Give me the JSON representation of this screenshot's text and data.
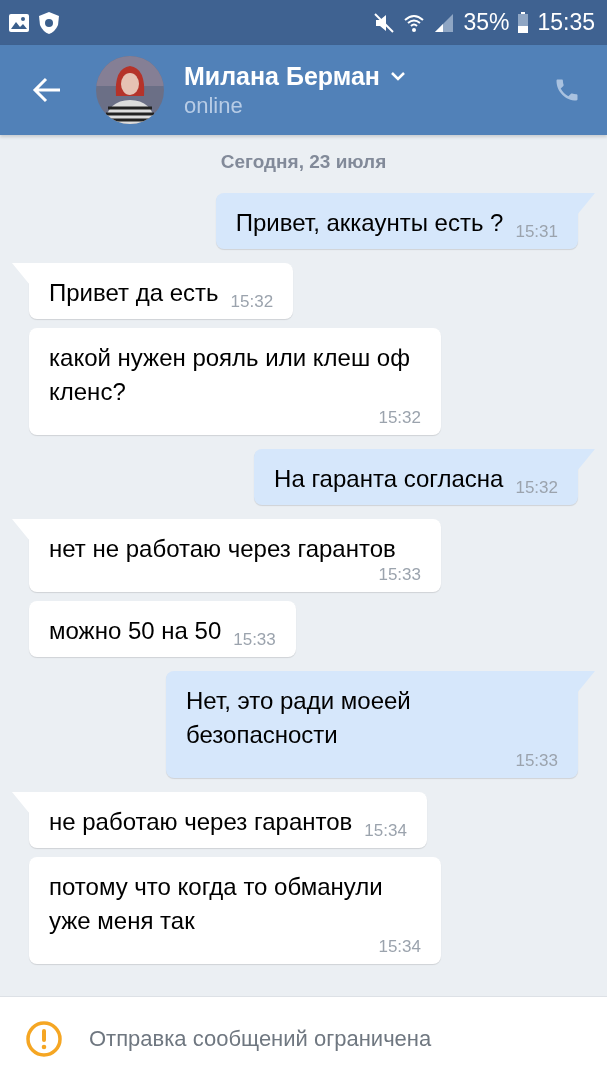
{
  "status_bar": {
    "battery": "35%",
    "time": "15:35"
  },
  "header": {
    "name": "Милана Берман",
    "status": "online"
  },
  "date": "Сегодня, 23 июля",
  "messages": [
    {
      "text": "Привет, аккаунты есть ?",
      "time": "15:31",
      "out": true,
      "tail": true
    },
    {
      "text": "Привет да есть",
      "time": "15:32",
      "out": false,
      "tail": true
    },
    {
      "text": "какой нужен рояль или клеш оф кленс?",
      "time": "15:32",
      "out": false,
      "tail": false
    },
    {
      "text": "На гаранта согласна",
      "time": "15:32",
      "out": true,
      "tail": true
    },
    {
      "text": "нет не работаю через гарантов",
      "time": "15:33",
      "out": false,
      "tail": true
    },
    {
      "text": "можно 50 на 50",
      "time": "15:33",
      "out": false,
      "tail": false
    },
    {
      "text": "Нет, это ради моеей безопасности",
      "time": "15:33",
      "out": true,
      "tail": true
    },
    {
      "text": "не работаю через гарантов",
      "time": "15:34",
      "out": false,
      "tail": true
    },
    {
      "text": "потому что когда то обманули уже меня так",
      "time": "15:34",
      "out": false,
      "tail": false
    }
  ],
  "notice": "Отправка сообщений ограничена"
}
